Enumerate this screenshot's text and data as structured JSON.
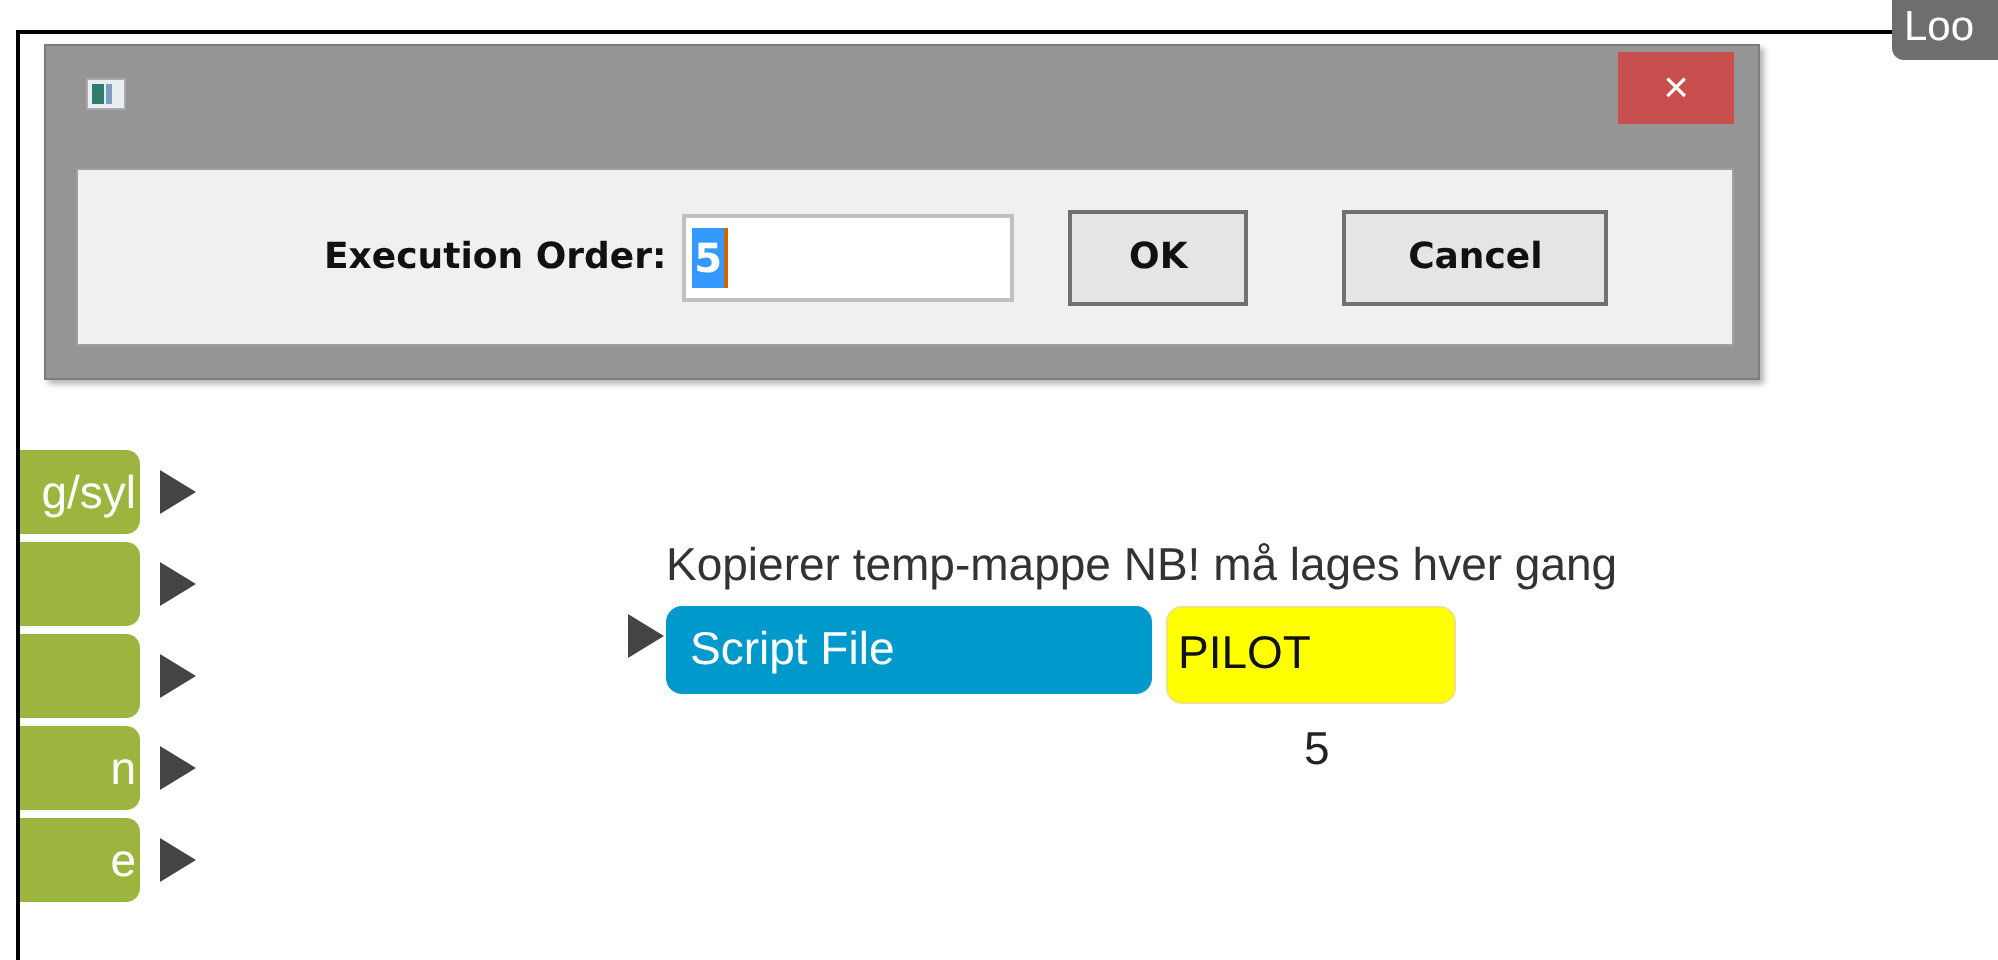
{
  "dialog": {
    "close_label": "×",
    "field_label": "Execution Order:",
    "field_value": "5",
    "buttons": [
      "OK",
      "Cancel"
    ]
  },
  "corner_tab": {
    "label": "Loo"
  },
  "side_nodes": [
    {
      "kind": "labeled",
      "label": "g/syl"
    },
    {
      "kind": "blank"
    },
    {
      "kind": "blank"
    },
    {
      "kind": "labeled",
      "label": "n"
    },
    {
      "kind": "labeled",
      "label": "e"
    }
  ],
  "script_node": {
    "comment": "Kopierer temp-mappe NB! må lages hver gang",
    "type_label": "Script File",
    "tag": "PILOT",
    "order": "5"
  }
}
